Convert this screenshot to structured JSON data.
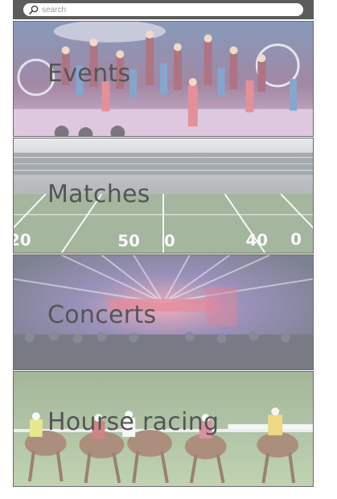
{
  "search": {
    "placeholder": "search",
    "icon": "search-icon"
  },
  "categories": [
    {
      "id": "events",
      "label": "Events",
      "image": "circus-performers-photo"
    },
    {
      "id": "matches",
      "label": "Matches",
      "image": "football-stadium-photo"
    },
    {
      "id": "concerts",
      "label": "Concerts",
      "image": "concert-stage-lights-photo"
    },
    {
      "id": "racing",
      "label": "Hourse racing",
      "image": "horse-race-photo"
    }
  ],
  "colors": {
    "topbar": "#5c5c5c",
    "label": "#555555",
    "tile_border": "#6b6b6b"
  }
}
